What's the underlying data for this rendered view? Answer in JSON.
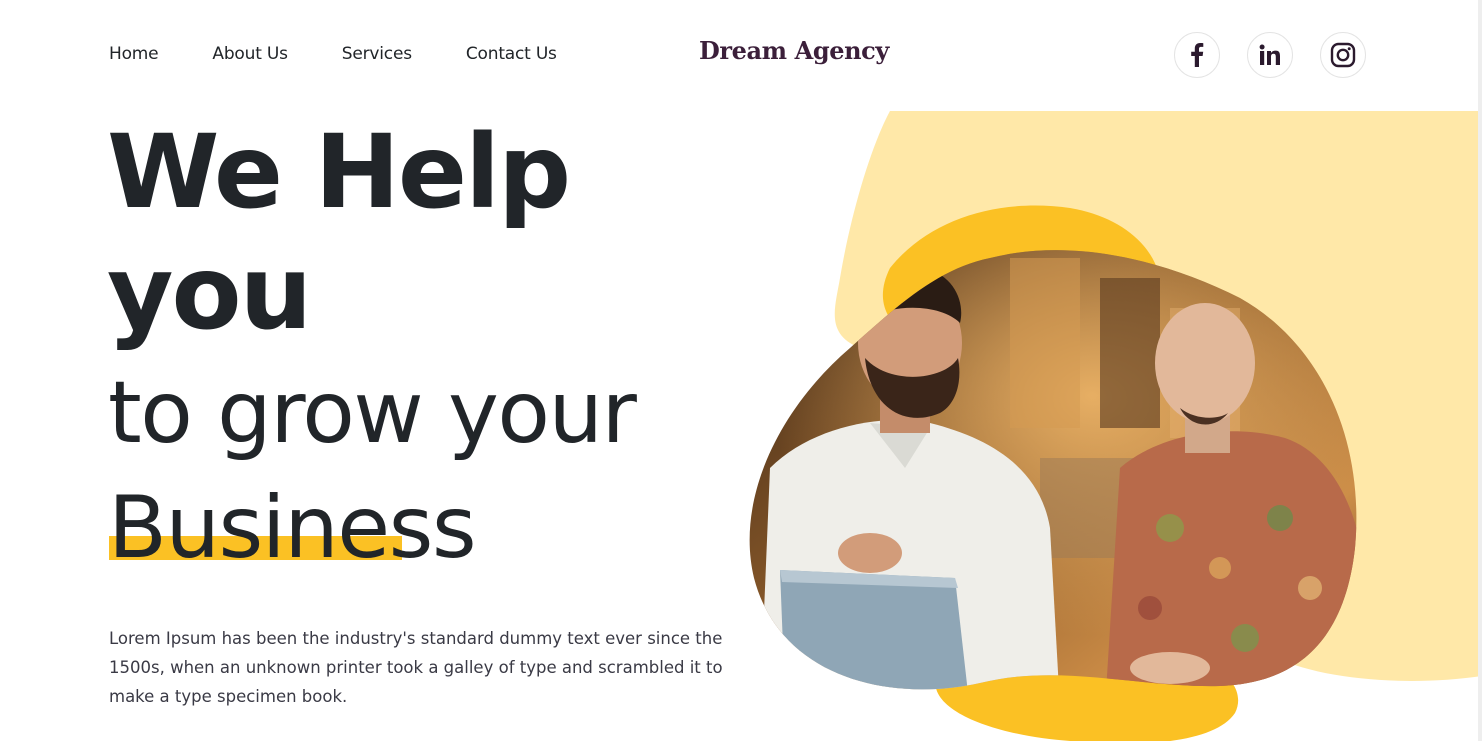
{
  "nav": {
    "items": [
      {
        "label": "Home"
      },
      {
        "label": "About Us"
      },
      {
        "label": "Services"
      },
      {
        "label": "Contact Us"
      }
    ]
  },
  "brand": {
    "name": "Dream Agency"
  },
  "socials": [
    {
      "icon": "facebook-icon"
    },
    {
      "icon": "linkedin-icon"
    },
    {
      "icon": "instagram-icon"
    }
  ],
  "hero": {
    "line1": "We Help",
    "line2": "you",
    "line3": "to grow your",
    "line4": "Business",
    "lead": "Lorem Ipsum has been the industry's standard dummy text ever since the 1500s, when an unknown printer took a galley of type and scrambled it to make a type specimen book."
  },
  "colors": {
    "accent": "#fbc124",
    "accent_light": "#ffe8a8",
    "brand_text": "#3b1f3a",
    "heading": "#212529"
  }
}
